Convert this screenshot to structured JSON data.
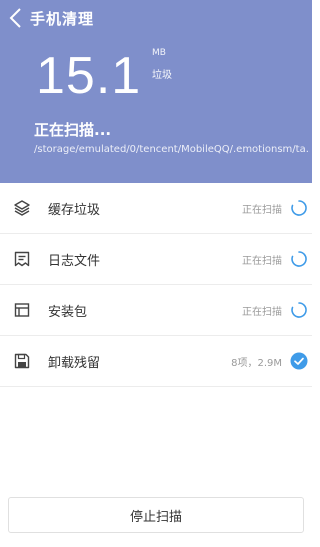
{
  "header": {
    "title": "手机清理",
    "size_value": "15.1",
    "size_unit": "MB",
    "size_kind": "垃圾",
    "status": "正在扫描...",
    "path": "/storage/emulated/0/tencent/MobileQQ/.emotionsm/ta..."
  },
  "list": {
    "items": [
      {
        "icon": "layers-icon",
        "label": "缓存垃圾",
        "status": "正在扫描",
        "state": "scanning"
      },
      {
        "icon": "log-file-icon",
        "label": "日志文件",
        "status": "正在扫描",
        "state": "scanning"
      },
      {
        "icon": "package-icon",
        "label": "安装包",
        "status": "正在扫描",
        "state": "scanning"
      },
      {
        "icon": "save-icon",
        "label": "卸载残留",
        "status": "8项，2.9M",
        "state": "done"
      }
    ]
  },
  "footer": {
    "stop_label": "停止扫描"
  },
  "colors": {
    "header_bg": "#7f8fcb",
    "accent": "#3f9be8"
  }
}
